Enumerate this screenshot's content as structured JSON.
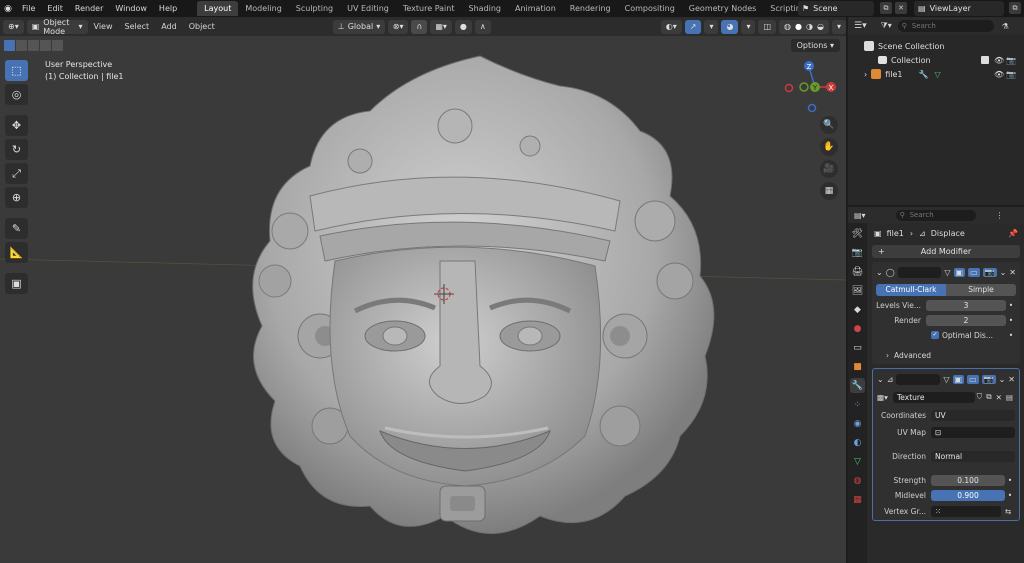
{
  "menu": [
    "File",
    "Edit",
    "Render",
    "Window",
    "Help"
  ],
  "workspaces": [
    "Layout",
    "Modeling",
    "Sculpting",
    "UV Editing",
    "Texture Paint",
    "Shading",
    "Animation",
    "Rendering",
    "Compositing",
    "Geometry Nodes",
    "Scripting"
  ],
  "active_workspace": "Layout",
  "scene_name": "Scene",
  "view_layer": "ViewLayer",
  "viewport_header": {
    "mode": "Object Mode",
    "menus": [
      "View",
      "Select",
      "Add",
      "Object"
    ],
    "transform_orientation": "Global",
    "options": "Options"
  },
  "viewport_info": {
    "line1": "User Perspective",
    "line2": "(1) Collection | file1"
  },
  "gizmo": {
    "z": "Z",
    "y": "Y",
    "x": "X"
  },
  "outliner": {
    "search_placeholder": "Search",
    "rows": [
      {
        "label": "Scene Collection"
      },
      {
        "label": "Collection"
      },
      {
        "label": "file1"
      }
    ]
  },
  "properties": {
    "search_placeholder": "Search",
    "breadcrumb_object": "file1",
    "breadcrumb_modifier": "Displace",
    "add_modifier": "Add Modifier",
    "subsurf": {
      "catmull": "Catmull-Clark",
      "simple": "Simple",
      "levels_label": "Levels Vie...",
      "levels_value": "3",
      "render_label": "Render",
      "render_value": "2",
      "optimal": "Optimal Dis...",
      "advanced": "Advanced"
    },
    "displace": {
      "texture": "Texture",
      "coordinates_label": "Coordinates",
      "coordinates_value": "UV",
      "uvmap_label": "UV Map",
      "direction_label": "Direction",
      "direction_value": "Normal",
      "strength_label": "Strength",
      "strength_value": "0.100",
      "midlevel_label": "Midlevel",
      "midlevel_value": "0.900",
      "vertex_label": "Vertex Gr..."
    }
  },
  "colors": {
    "accent": "#4772b3",
    "gizmo_x": "#c83c3c",
    "gizmo_y": "#6a9a2c",
    "gizmo_z": "#3a6fc8"
  }
}
